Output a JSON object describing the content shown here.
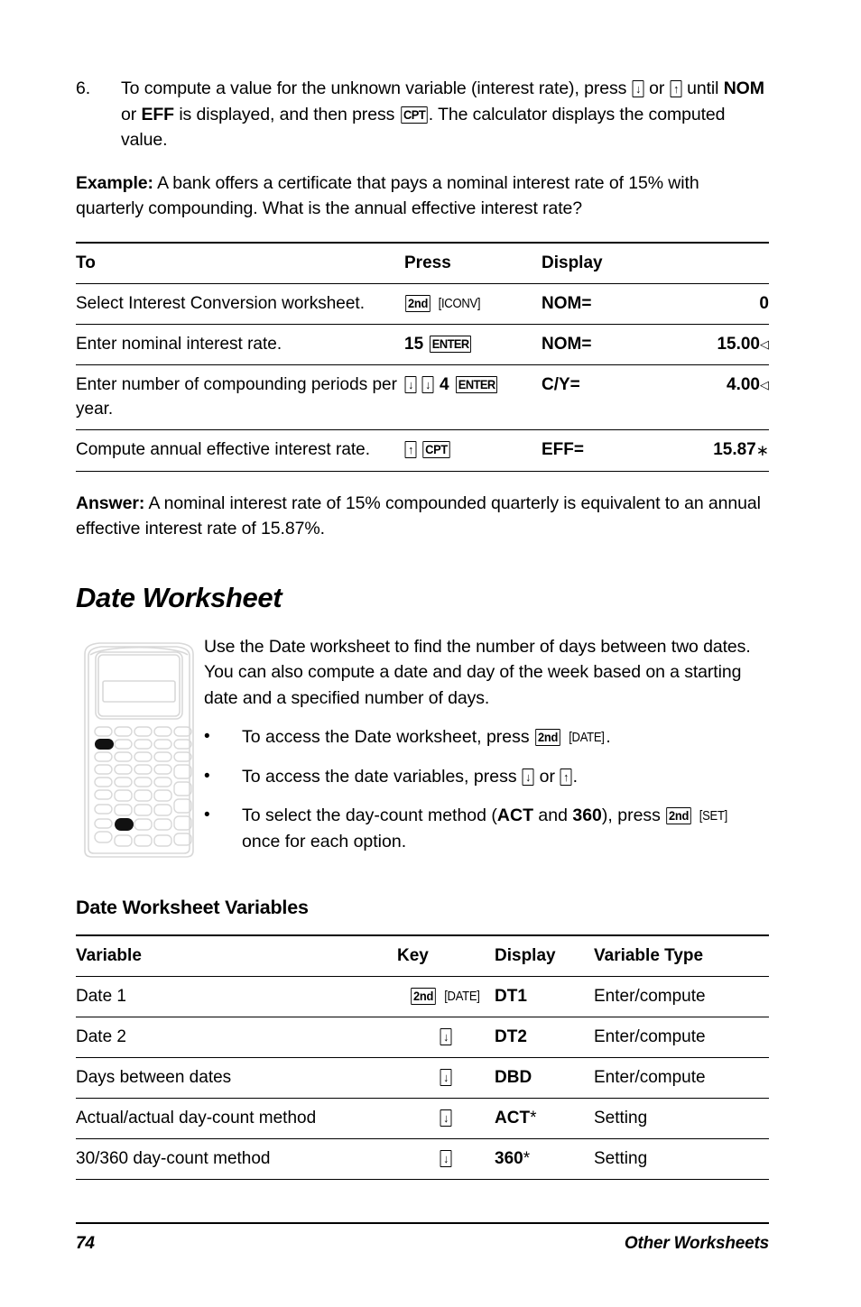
{
  "step": {
    "number": "6.",
    "text_1": "To compute a value for the unknown variable (interest rate), press ",
    "key_down_1": "↓",
    "text_2": " or ",
    "key_up_1": "↑",
    "text_3": " until ",
    "bold_nom": "NOM",
    "text_4": " or ",
    "bold_eff": "EFF",
    "text_5": " is displayed, and then press ",
    "key_cpt": "CPT",
    "text_6": ". The calculator displays the computed value."
  },
  "example": {
    "label": "Example:",
    "text": " A bank offers a certificate that pays a nominal interest rate of 15% with quarterly compounding. What is the annual effective interest rate?"
  },
  "table1": {
    "headers": [
      "To",
      "Press",
      "Display"
    ],
    "rows": [
      {
        "to": "Select Interest Conversion worksheet.",
        "press_keys": [
          {
            "type": "boxed",
            "label": "2nd"
          },
          {
            "type": "bracket",
            "label": "ICONV"
          }
        ],
        "display_label": "NOM=",
        "display_value": "0",
        "marker": ""
      },
      {
        "to": "Enter nominal interest rate.",
        "press_keys": [
          {
            "type": "plain-bold",
            "label": "15"
          },
          {
            "type": "boxed",
            "label": "ENTER"
          }
        ],
        "display_label": "NOM=",
        "display_value": "15.00",
        "marker": "◁"
      },
      {
        "to": "Enter number of compounding periods per year.",
        "press_keys": [
          {
            "type": "boxed-arrow",
            "label": "↓"
          },
          {
            "type": "boxed-arrow",
            "label": "↓"
          },
          {
            "type": "plain-bold",
            "label": "4"
          },
          {
            "type": "boxed",
            "label": "ENTER"
          }
        ],
        "display_label": "C/Y=",
        "display_value": "4.00",
        "marker": "◁"
      },
      {
        "to": "Compute annual effective interest rate.",
        "press_keys": [
          {
            "type": "boxed-arrow",
            "label": "↑"
          },
          {
            "type": "boxed",
            "label": "CPT"
          }
        ],
        "display_label": "EFF=",
        "display_value": "15.87",
        "marker": "∗"
      }
    ]
  },
  "answer": {
    "label": "Answer:",
    "text": " A nominal interest rate of 15% compounded quarterly is equivalent to an annual effective interest rate of 15.87%."
  },
  "section": {
    "title": "Date Worksheet",
    "intro": "Use the Date worksheet to find the number of days between two dates. You can also compute a date and day of the week based on a starting date and a specified number of days.",
    "bullet_char": "•",
    "bullets": [
      {
        "parts": [
          {
            "kind": "text",
            "value": "To access the Date worksheet, press "
          },
          {
            "kind": "boxed",
            "value": "2nd"
          },
          {
            "kind": "bracket",
            "value": "DATE"
          },
          {
            "kind": "text",
            "value": "."
          }
        ]
      },
      {
        "parts": [
          {
            "kind": "text",
            "value": "To access the date variables, press "
          },
          {
            "kind": "boxed-arrow",
            "value": "↓"
          },
          {
            "kind": "text",
            "value": " or "
          },
          {
            "kind": "boxed-arrow",
            "value": "↑"
          },
          {
            "kind": "text",
            "value": "."
          }
        ]
      },
      {
        "parts": [
          {
            "kind": "text",
            "value": "To select the day-count method ("
          },
          {
            "kind": "bold",
            "value": "ACT"
          },
          {
            "kind": "text",
            "value": " and "
          },
          {
            "kind": "bold",
            "value": "360"
          },
          {
            "kind": "text",
            "value": "), press "
          },
          {
            "kind": "boxed",
            "value": "2nd"
          },
          {
            "kind": "bracket",
            "value": "SET"
          },
          {
            "kind": "text",
            "value": " once for each option."
          }
        ]
      }
    ]
  },
  "subsection": {
    "title": "Date Worksheet Variables"
  },
  "table2": {
    "headers": [
      "Variable",
      "Key",
      "Display",
      "Variable Type"
    ],
    "rows": [
      {
        "variable": "Date 1",
        "keys": [
          {
            "type": "boxed",
            "label": "2nd"
          },
          {
            "type": "bracket",
            "label": "DATE"
          }
        ],
        "display": "DT1",
        "display_marker": "",
        "type": "Enter/compute"
      },
      {
        "variable": "Date 2",
        "keys": [
          {
            "type": "boxed-arrow",
            "label": "↓"
          }
        ],
        "display": "DT2",
        "display_marker": "",
        "type": "Enter/compute"
      },
      {
        "variable": "Days between dates",
        "keys": [
          {
            "type": "boxed-arrow",
            "label": "↓"
          }
        ],
        "display": "DBD",
        "display_marker": "",
        "type": "Enter/compute"
      },
      {
        "variable": "Actual/actual day-count method",
        "keys": [
          {
            "type": "boxed-arrow",
            "label": "↓"
          }
        ],
        "display": "ACT",
        "display_marker": "*",
        "type": "Setting"
      },
      {
        "variable": "30/360 day-count method",
        "keys": [
          {
            "type": "boxed-arrow",
            "label": "↓"
          }
        ],
        "display": "360",
        "display_marker": "*",
        "type": "Setting"
      }
    ]
  },
  "footer": {
    "page_number": "74",
    "section_name": "Other Worksheets"
  },
  "illustration": {
    "name": "ti-ba-ii-plus-calculator",
    "outline_color": "#d8d8d8",
    "highlight_color": "#111111"
  }
}
